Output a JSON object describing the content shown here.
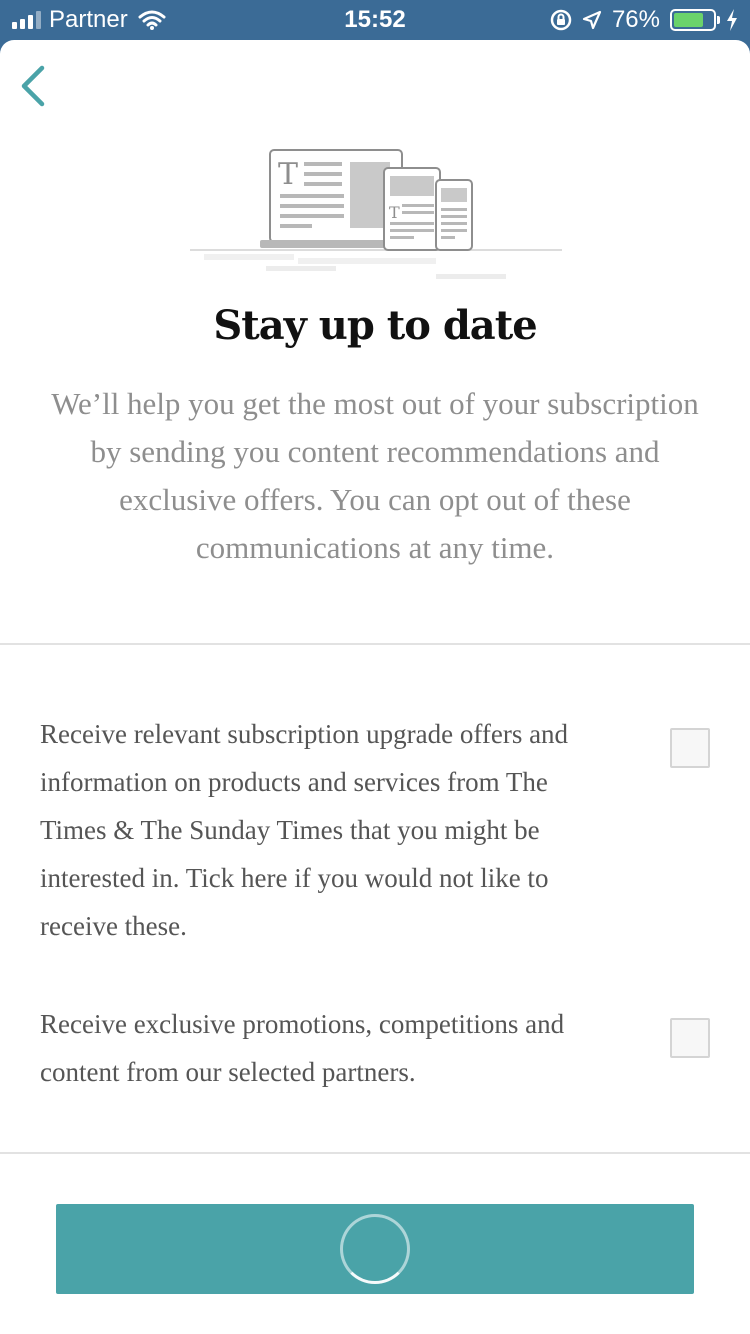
{
  "status_bar": {
    "carrier": "Partner",
    "time": "15:52",
    "battery_percent": "76%",
    "battery_level": 0.76,
    "colors": {
      "background": "#3b6b96",
      "battery": "#6bd36b"
    }
  },
  "nav": {
    "back_icon": "chevron-left-icon",
    "accent_color": "#4aa3a8"
  },
  "illustration": {
    "icon": "devices-newspaper-illustration"
  },
  "content": {
    "title": "Stay up to date",
    "intro": "We’ll help you get the most out of your subscription by sending you content recommendations and exclusive offers. You can opt out of these communications at any time."
  },
  "preferences": [
    {
      "text": "Receive relevant subscription upgrade offers and information on products and services from The Times & The Sunday Times that you might be interested in. Tick here if you would not like to receive these.",
      "checked": false
    },
    {
      "text": "Receive exclusive promotions, competitions and content from our selected partners.",
      "checked": false
    }
  ],
  "submit": {
    "state": "loading",
    "icon": "loading-spinner-icon",
    "color": "#4aa3a8"
  }
}
